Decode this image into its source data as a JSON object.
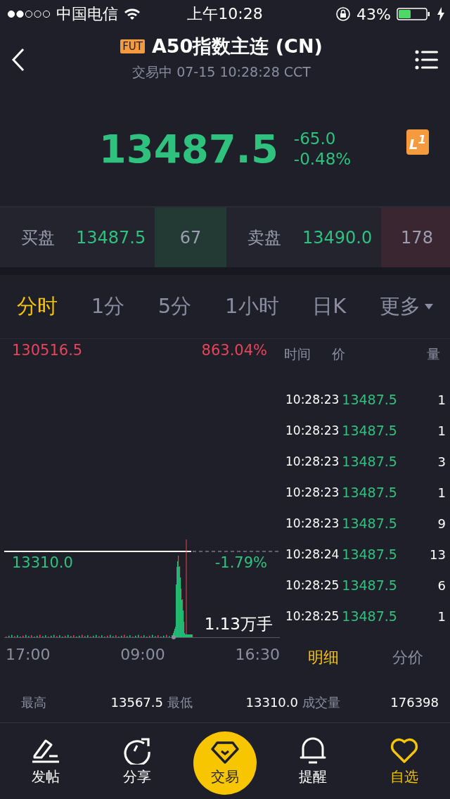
{
  "status_bar": {
    "carrier": "中国电信",
    "time": "上午10:28",
    "battery": "43%"
  },
  "header": {
    "badge": "FUT",
    "title": "A50指数主连 (CN)",
    "subtitle": "交易中 07-15 10:28:28 CCT"
  },
  "quote": {
    "price": "13487.5",
    "change": "-65.0",
    "change_pct": "-0.48%",
    "level_badge": "L$^{1}$"
  },
  "order_book": [
    {
      "kind": "bid",
      "label": "买盘",
      "price": "13487.5",
      "qty": "67"
    },
    {
      "kind": "ask",
      "label": "卖盘",
      "price": "13490.0",
      "qty": "178"
    }
  ],
  "periods": [
    {
      "label": "分时",
      "selected": true,
      "kind": "tab"
    },
    {
      "label": "1分",
      "selected": false,
      "kind": "tab"
    },
    {
      "label": "5分",
      "selected": false,
      "kind": "tab"
    },
    {
      "label": "1小时",
      "selected": false,
      "kind": "tab"
    },
    {
      "label": "日K",
      "selected": false,
      "kind": "tab"
    },
    {
      "label": "更多",
      "selected": false,
      "kind": "menu"
    }
  ],
  "chart": {
    "top_price": "130516.5",
    "top_pct": "863.04%",
    "base_price": "13310.0",
    "base_pct": "-1.79%",
    "volume": "1.13万手",
    "x_labels": [
      "17:00",
      "09:00",
      "16:30"
    ]
  },
  "trades": {
    "columns": [
      "时间",
      "价",
      "量"
    ],
    "rows": [
      {
        "time": "10:28:23",
        "price": "13487.5",
        "qty": "1"
      },
      {
        "time": "10:28:23",
        "price": "13487.5",
        "qty": "1"
      },
      {
        "time": "10:28:23",
        "price": "13487.5",
        "qty": "3"
      },
      {
        "time": "10:28:23",
        "price": "13487.5",
        "qty": "1"
      },
      {
        "time": "10:28:23",
        "price": "13487.5",
        "qty": "9"
      },
      {
        "time": "10:28:24",
        "price": "13487.5",
        "qty": "13"
      },
      {
        "time": "10:28:25",
        "price": "13487.5",
        "qty": "6"
      },
      {
        "time": "10:28:25",
        "price": "13487.5",
        "qty": "1"
      }
    ],
    "tabs": [
      {
        "label": "明细",
        "selected": true
      },
      {
        "label": "分价",
        "selected": false
      }
    ]
  },
  "stats": [
    {
      "label": "最高",
      "value": "13567.5"
    },
    {
      "label": "最低",
      "value": "13310.0"
    },
    {
      "label": "成交量",
      "value": "176398"
    }
  ],
  "nav": [
    {
      "kind": "pen",
      "label": "发帖",
      "selected": false
    },
    {
      "kind": "refresh",
      "label": "分享",
      "selected": false
    },
    {
      "kind": "trade",
      "label": "交易",
      "selected": false
    },
    {
      "kind": "bell",
      "label": "提醒",
      "selected": false
    },
    {
      "kind": "heart",
      "label": "自选",
      "selected": true
    }
  ]
}
